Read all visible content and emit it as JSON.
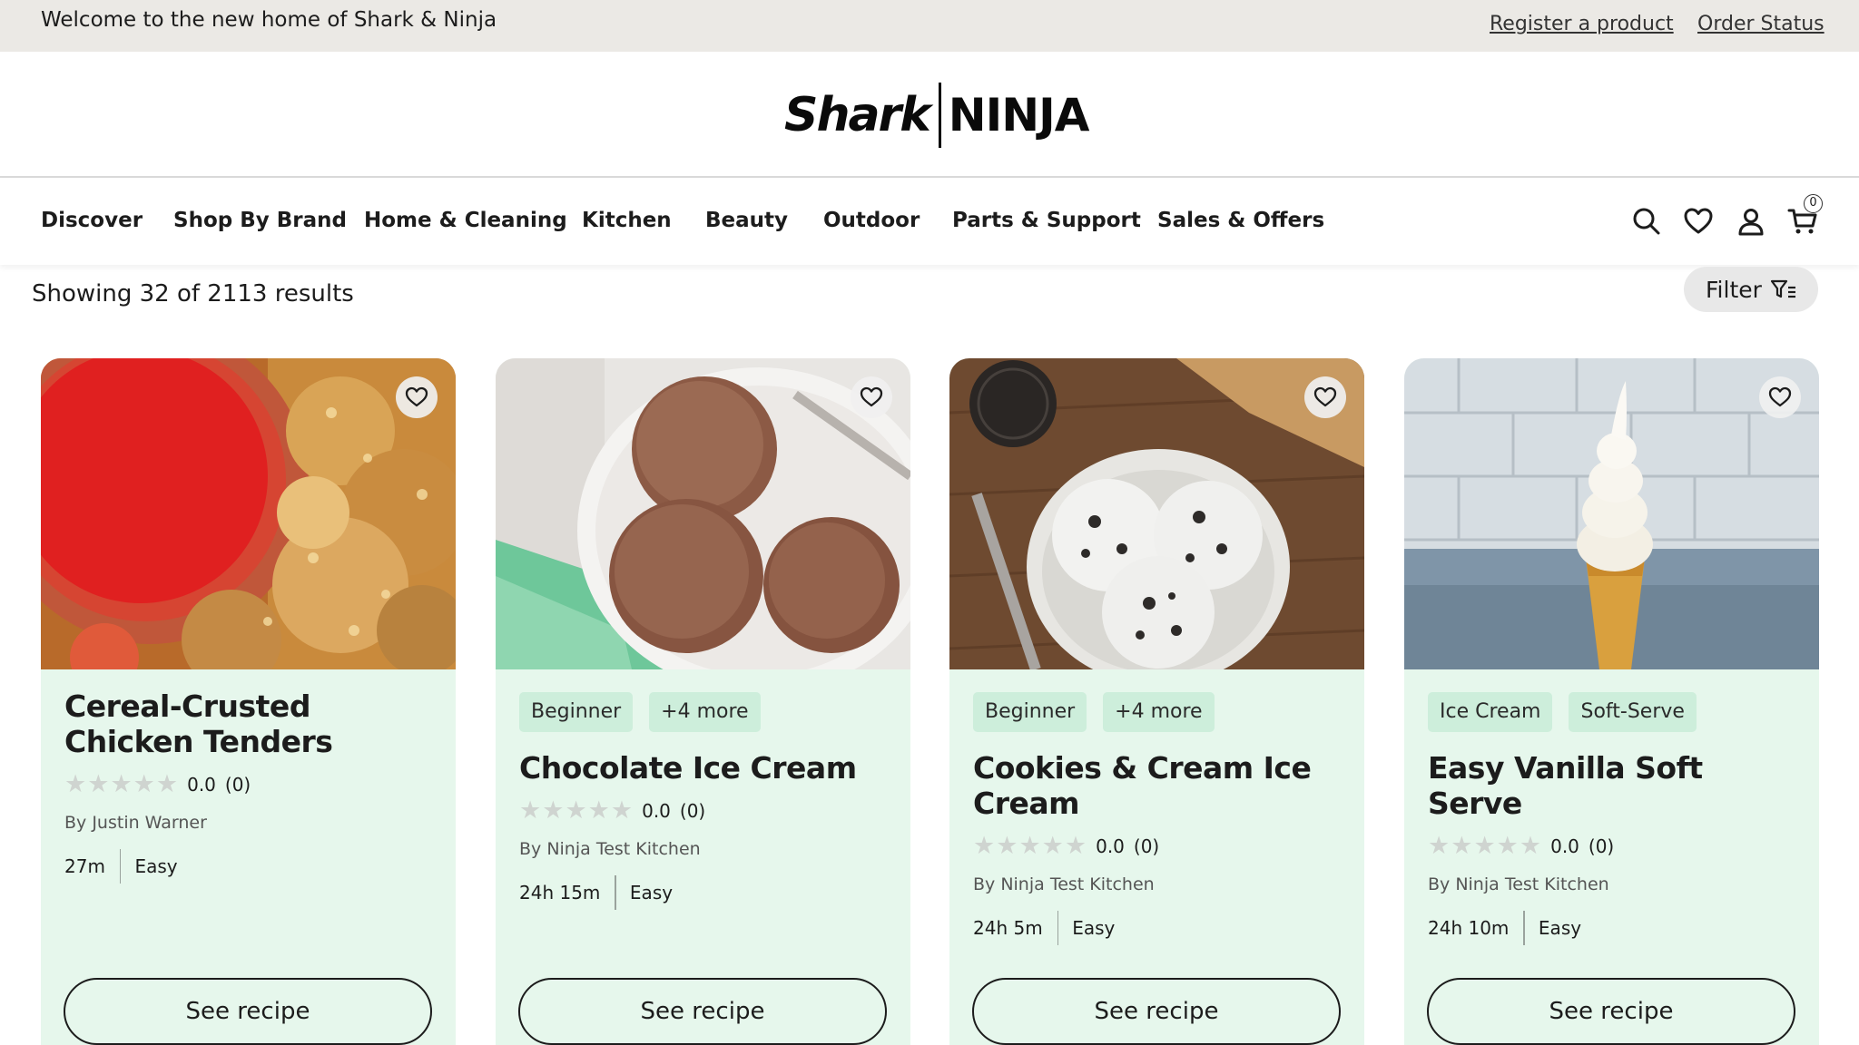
{
  "topbar": {
    "welcome": "Welcome to the new home of Shark & Ninja",
    "register_link": "Register a product",
    "order_link": "Order Status"
  },
  "logo": {
    "left_word": "Shark",
    "right_word": "NINJA"
  },
  "nav": {
    "items": [
      "Discover",
      "Shop By Brand",
      "Home & Cleaning",
      "Kitchen",
      "Beauty",
      "Outdoor",
      "Parts & Support",
      "Sales & Offers"
    ],
    "icons": [
      "search-icon",
      "heart-icon",
      "user-icon",
      "cart-icon"
    ],
    "cart_count": "0"
  },
  "results": {
    "text": "Showing 32 of 2113 results",
    "filter_label": "Filter"
  },
  "colors": {
    "card_bg": "#e6f7ec",
    "tag_bg": "#cdeedb",
    "topbar_bg": "#ebe9e5"
  },
  "cards": [
    {
      "tags": [],
      "title": "Cereal-Crusted Chicken Tenders",
      "score": "0.0",
      "count": "(0)",
      "author": "By Justin Warner",
      "time": "27m",
      "difficulty": "Easy",
      "button": "See recipe"
    },
    {
      "tags": [
        "Beginner",
        "+4 more"
      ],
      "title": "Chocolate Ice Cream",
      "score": "0.0",
      "count": "(0)",
      "author": "By Ninja Test Kitchen",
      "time": "24h 15m",
      "difficulty": "Easy",
      "button": "See recipe"
    },
    {
      "tags": [
        "Beginner",
        "+4 more"
      ],
      "title": "Cookies & Cream Ice Cream",
      "score": "0.0",
      "count": "(0)",
      "author": "By Ninja Test Kitchen",
      "time": "24h 5m",
      "difficulty": "Easy",
      "button": "See recipe"
    },
    {
      "tags": [
        "Ice Cream",
        "Soft-Serve"
      ],
      "title": "Easy Vanilla Soft Serve",
      "score": "0.0",
      "count": "(0)",
      "author": "By Ninja Test Kitchen",
      "time": "24h 10m",
      "difficulty": "Easy",
      "button": "See recipe"
    }
  ]
}
